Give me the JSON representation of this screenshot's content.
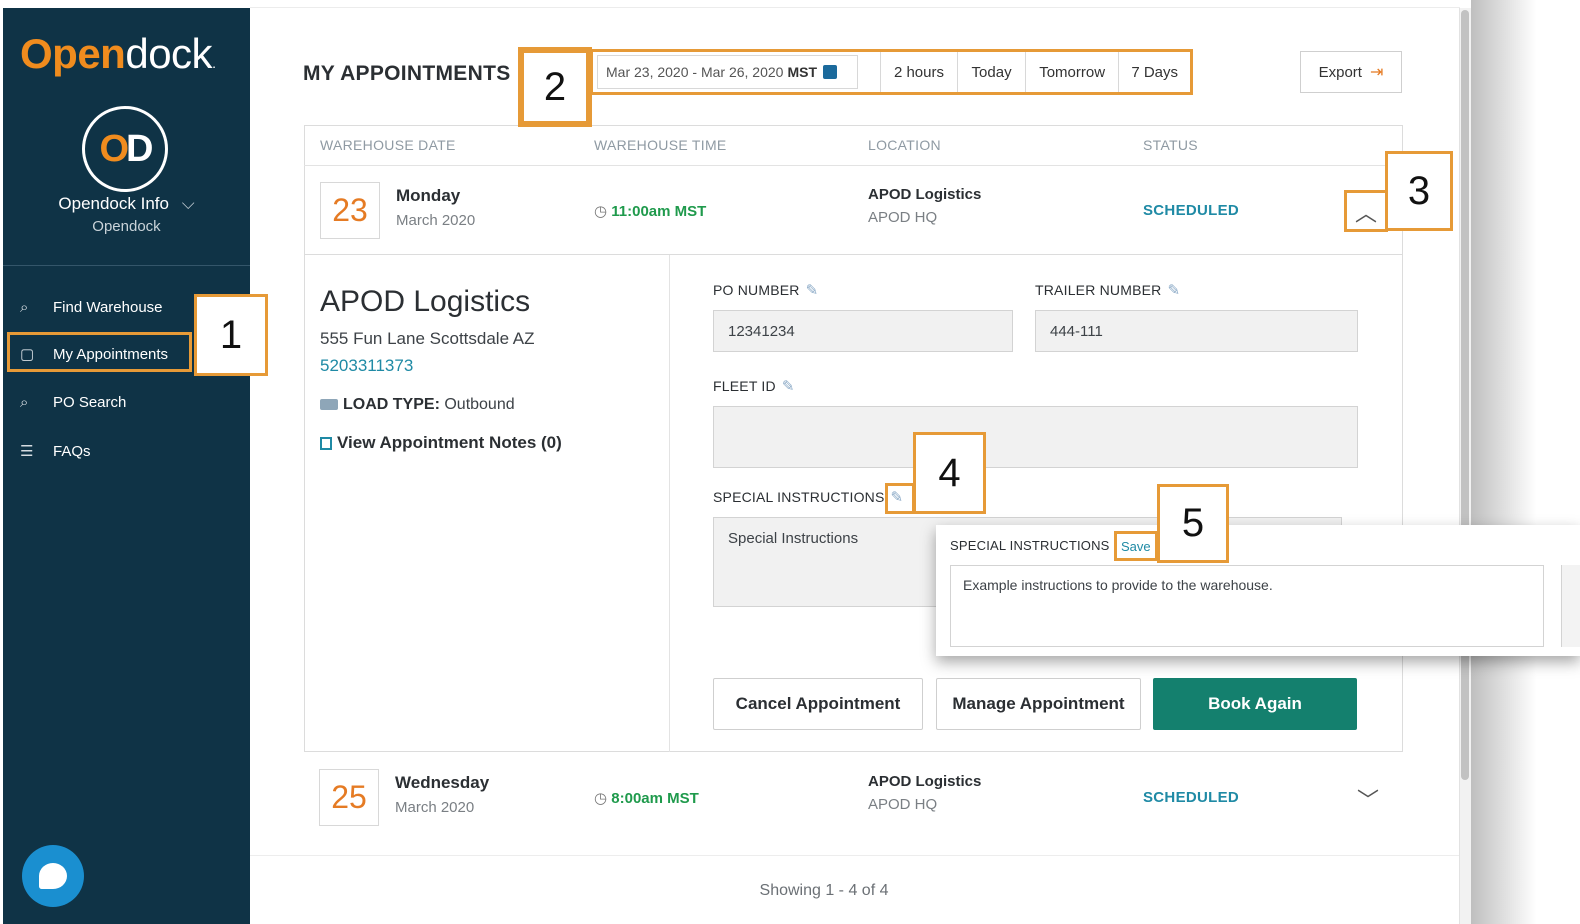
{
  "brand": {
    "logo_open": "Open",
    "logo_dock": "dock",
    "logo_dot": ".",
    "avatar_o": "O",
    "avatar_d": "D",
    "accent": "#f08c1e",
    "sidebar_bg": "#0f3346"
  },
  "org": {
    "name": "Opendock Info",
    "caret": "⌵",
    "sub": "Opendock"
  },
  "nav": [
    {
      "icon": "⌕",
      "label": "Find Warehouse"
    },
    {
      "icon": "▢",
      "label": "My Appointments"
    },
    {
      "icon": "⌕",
      "label": "PO Search"
    },
    {
      "icon": "☰",
      "label": "FAQs"
    }
  ],
  "header": {
    "title": "MY APPOINTMENTS",
    "date_range": "Mar 23, 2020 - Mar 26, 2020",
    "tz": "MST",
    "quick_ranges": [
      "2 hours",
      "Today",
      "Tomorrow",
      "7 Days"
    ],
    "export_label": "Export",
    "export_icon": "⇥"
  },
  "table": {
    "columns": [
      "WAREHOUSE DATE",
      "WAREHOUSE TIME",
      "LOCATION",
      "STATUS"
    ],
    "rows": [
      {
        "day": "23",
        "weekday": "Monday",
        "month": "March 2020",
        "time": "11:00am MST",
        "location": "APOD Logistics",
        "location_sub": "APOD HQ",
        "status": "SCHEDULED",
        "chevron": "︿"
      },
      {
        "day": "25",
        "weekday": "Wednesday",
        "month": "March 2020",
        "time": "8:00am MST",
        "location": "APOD Logistics",
        "location_sub": "APOD HQ",
        "status": "SCHEDULED",
        "chevron": "﹀"
      }
    ]
  },
  "detail": {
    "company": "APOD Logistics",
    "address": "555 Fun Lane Scottsdale AZ",
    "phone": "5203311373",
    "load_type_label": "LOAD TYPE:",
    "load_type_value": "Outbound",
    "notes_link": "View Appointment Notes (0)",
    "po_label": "PO NUMBER",
    "po_value": "12341234",
    "trailer_label": "TRAILER NUMBER",
    "trailer_value": "444-111",
    "fleet_label": "FLEET ID",
    "fleet_value": "",
    "special_label": "SPECIAL INSTRUCTIONS",
    "special_placeholder": "Special Instructions",
    "buttons": {
      "cancel": "Cancel Appointment",
      "manage": "Manage Appointment",
      "book": "Book Again"
    }
  },
  "popup": {
    "label": "SPECIAL INSTRUCTIONS",
    "save": "Save",
    "text": "Example instructions to provide to the warehouse."
  },
  "callouts": [
    "1",
    "2",
    "3",
    "4",
    "5"
  ],
  "footer": {
    "showing": "Showing 1 - 4 of 4"
  },
  "colors": {
    "highlight": "#e69a37",
    "time_green": "#1f9a4c",
    "status_teal": "#1f8aa5",
    "book_btn": "#14806e"
  }
}
